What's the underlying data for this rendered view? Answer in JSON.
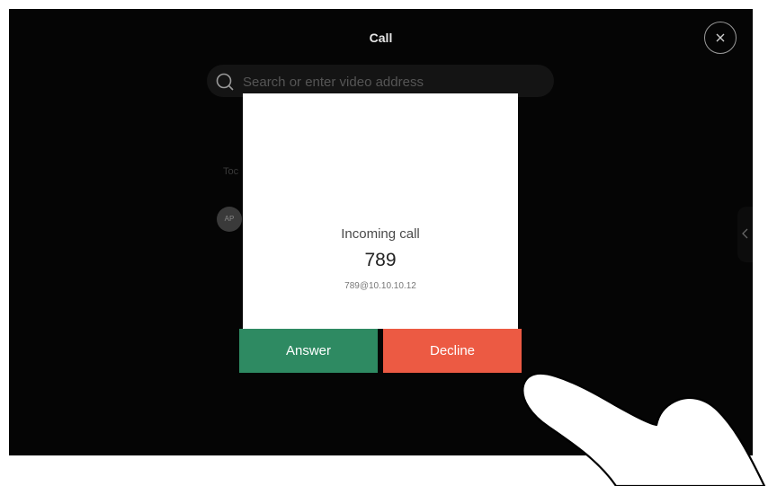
{
  "screen": {
    "title": "Call",
    "search": {
      "placeholder": "Search or enter video address"
    },
    "section_label": "Toc",
    "avatar_initials": "AP"
  },
  "dialog": {
    "title": "Incoming call",
    "number": "789",
    "address": "789@10.10.10.12",
    "answer_label": "Answer",
    "decline_label": "Decline"
  },
  "colors": {
    "answer": "#2e8a62",
    "decline": "#ec5a43",
    "screen_bg": "#050505"
  },
  "icons": {
    "close": "close-icon",
    "search": "search-icon",
    "side": "chevron-left-icon"
  }
}
